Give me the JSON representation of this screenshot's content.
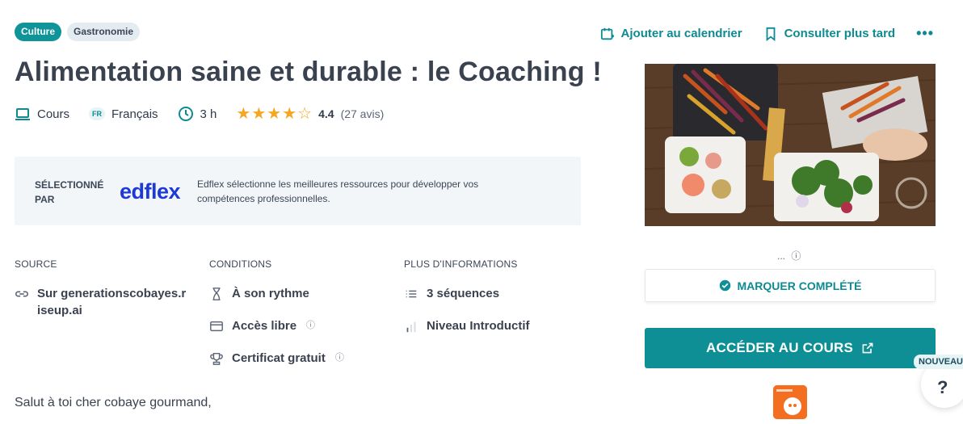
{
  "tags": [
    "Culture",
    "Gastronomie"
  ],
  "actions": {
    "calendar_label": "Ajouter au calendrier",
    "later_label": "Consulter plus tard",
    "more_label": "•••"
  },
  "title": "Alimentation saine et durable : le Coaching !",
  "meta": {
    "type": "Cours",
    "lang_badge": "FR",
    "language": "Français",
    "duration": "3 h",
    "rating_value": 4.4,
    "rating_text": "4.4",
    "rating_count": "(27 avis)",
    "stars_max": 5
  },
  "selection": {
    "label": "SÉLECTIONNÉ PAR",
    "logo_text": "edflex",
    "description": "Edflex sélectionne les meilleures ressources pour développer vos compétences professionnelles."
  },
  "source": {
    "title": "SOURCE",
    "link": "Sur generationscobayes.riseup.ai"
  },
  "conditions": {
    "title": "CONDITIONS",
    "pace": "À son rythme",
    "access": "Accès libre",
    "certificate": "Certificat gratuit"
  },
  "more_info": {
    "title": "PLUS D'INFORMATIONS",
    "sequences": "3 séquences",
    "level": "Niveau Introductif"
  },
  "sidebar": {
    "dots": "...",
    "complete_label": "MARQUER COMPLÉTÉ",
    "access_label": "ACCÉDER AU COURS"
  },
  "help": {
    "badge": "NOUVEAU",
    "symbol": "?"
  },
  "greeting": "Salut à toi cher cobaye gourmand,",
  "colors": {
    "accent": "#0e8f96",
    "star": "#f5a623",
    "edflex": "#1d3ad6",
    "provider": "#f36e21"
  }
}
